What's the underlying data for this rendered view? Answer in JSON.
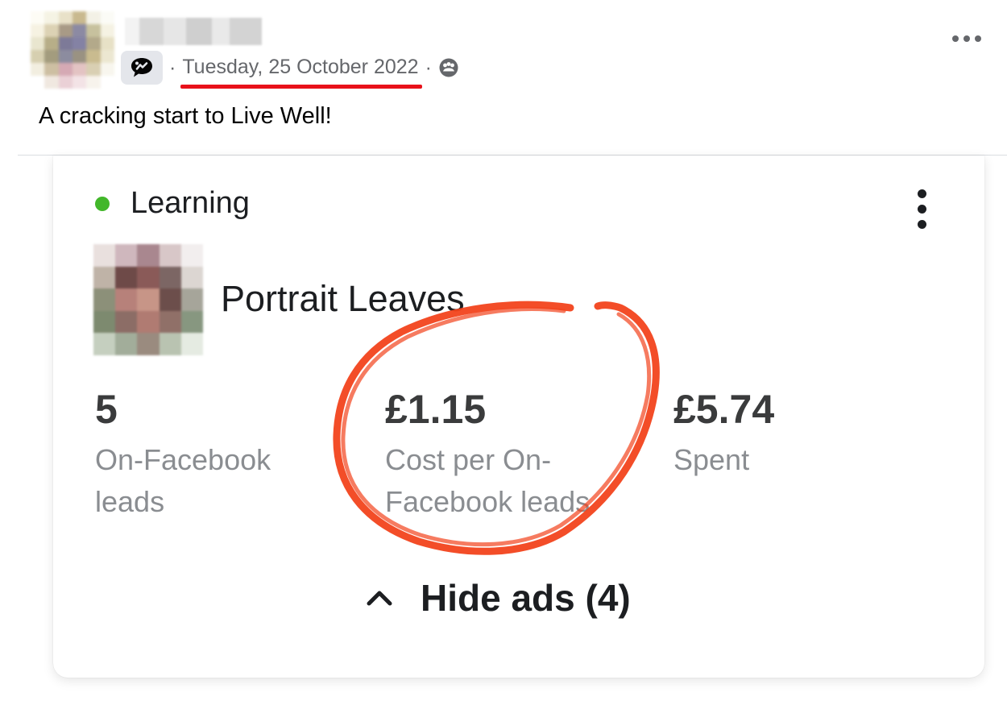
{
  "post": {
    "date": "Tuesday, 25 October 2022",
    "separator": "·",
    "text": "A cracking start to Live Well!",
    "group_icon": "group-chat-icon",
    "audience_icon": "members-audience-icon",
    "more_icon": "more-horizontal-icon"
  },
  "ad_card": {
    "status": "Learning",
    "status_color": "#42b72a",
    "menu_icon": "more-vertical-icon",
    "ad_name": "Portrait Leaves",
    "metrics": [
      {
        "value": "5",
        "label": "On-Facebook leads"
      },
      {
        "value": "£1.15",
        "label": "Cost per On-Facebook leads"
      },
      {
        "value": "£5.74",
        "label": "Spent"
      }
    ],
    "hide_ads": {
      "label": "Hide ads (4)",
      "icon": "chevron-up-icon"
    }
  },
  "colors": {
    "annotation_red": "#f2431c",
    "underline_red": "#e8111a",
    "muted_text": "#65676b"
  }
}
